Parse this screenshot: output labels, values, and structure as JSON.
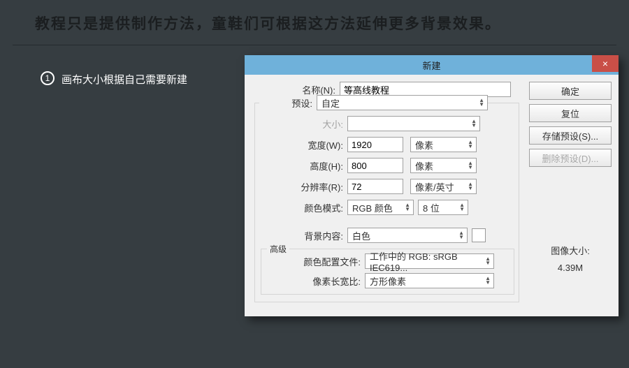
{
  "tutorial": {
    "header": "教程只是提供制作方法，童鞋们可根据这方法延伸更多背景效果。",
    "step_number": "1",
    "step_text": "画布大小根据自己需要新建"
  },
  "dialog": {
    "title": "新建",
    "close": "×",
    "labels": {
      "name": "名称(N):",
      "preset": "预设:",
      "size": "大小:",
      "width": "宽度(W):",
      "height": "高度(H):",
      "resolution": "分辨率(R):",
      "color_mode": "颜色模式:",
      "bg_content": "背景内容:",
      "advanced": "高级",
      "color_profile": "颜色配置文件:",
      "pixel_aspect": "像素长宽比:"
    },
    "values": {
      "name": "等高线教程",
      "preset": "自定",
      "size": "",
      "width": "1920",
      "width_unit": "像素",
      "height": "800",
      "height_unit": "像素",
      "resolution": "72",
      "resolution_unit": "像素/英寸",
      "color_mode": "RGB 颜色",
      "bits": "8 位",
      "bg_content": "白色",
      "color_profile": "工作中的 RGB: sRGB IEC619...",
      "pixel_aspect": "方形像素"
    },
    "buttons": {
      "ok": "确定",
      "reset": "复位",
      "save_preset": "存储预设(S)...",
      "delete_preset": "删除预设(D)..."
    },
    "info": {
      "label": "图像大小:",
      "value": "4.39M"
    }
  }
}
